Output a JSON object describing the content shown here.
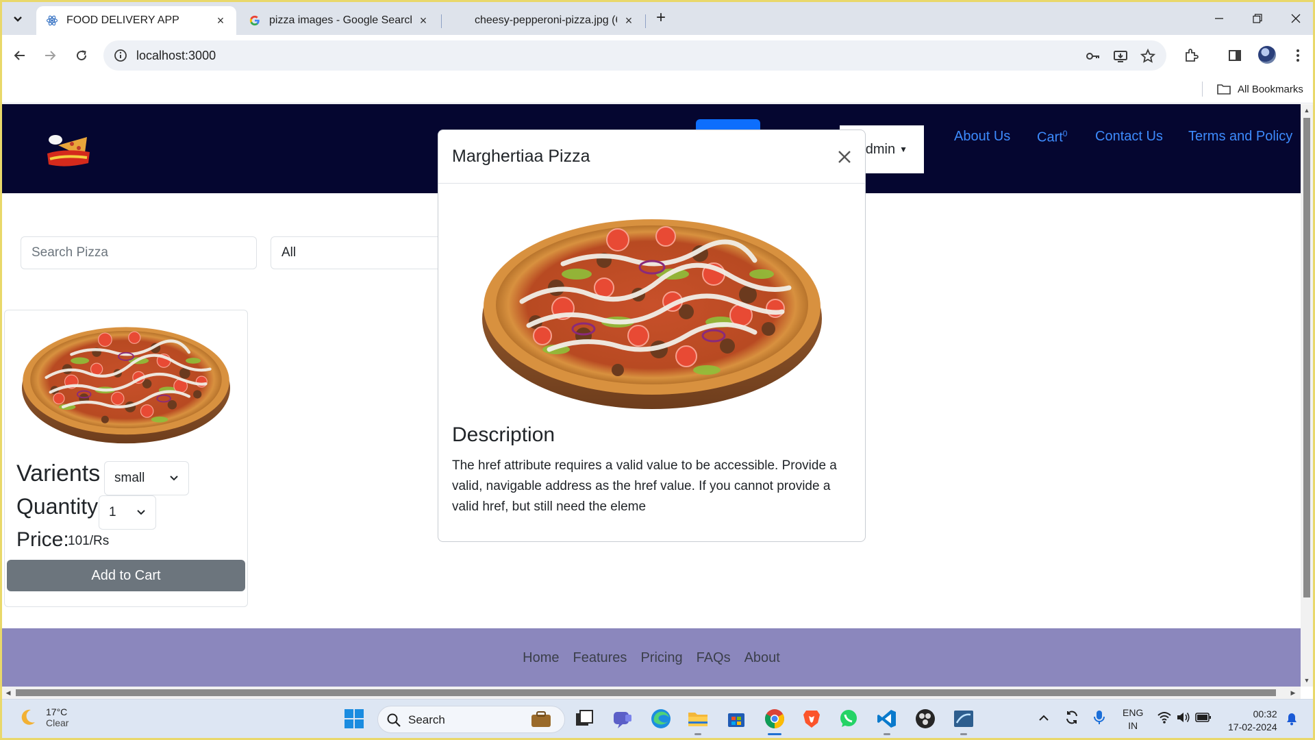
{
  "browser": {
    "tabs": [
      {
        "title": "FOOD DELIVERY APP",
        "active": true
      },
      {
        "title": "pizza images - Google Search",
        "active": false
      },
      {
        "title": "cheesy-pepperoni-pizza.jpg (61",
        "active": false
      }
    ],
    "url": "localhost:3000",
    "bookmarks_label": "All Bookmarks"
  },
  "navbar": {
    "admin_label": "dmin",
    "links": [
      "About Us",
      "Cart",
      "Contact Us",
      "Terms and Policy"
    ],
    "cart_count": "0"
  },
  "filters": {
    "search_placeholder": "Search Pizza",
    "category_value": "All"
  },
  "card": {
    "variants_label": "Varients",
    "variant_value": "small",
    "quantity_label": "Quantity",
    "quantity_value": "1",
    "price_label": "Price:",
    "price_value": "101/Rs",
    "add_button": "Add to Cart"
  },
  "modal": {
    "title": "Marghertiaa Pizza",
    "description_title": "Description",
    "description_text": "The href attribute requires a valid value to be accessible. Provide a valid, navigable address as the href value. If you cannot provide a valid href, but still need the eleme"
  },
  "footer": {
    "links": [
      "Home",
      "Features",
      "Pricing",
      "FAQs",
      "About"
    ]
  },
  "taskbar": {
    "temperature": "17°C",
    "weather": "Clear",
    "search_label": "Search",
    "lang_top": "ENG",
    "lang_bottom": "IN",
    "time": "00:32",
    "date": "17-02-2024"
  },
  "colors": {
    "navbar_bg": "#050630",
    "link": "#3d8bfd",
    "footer_bg": "#8b87bd",
    "button_gray": "#6c757d",
    "primary": "#0d6efd"
  }
}
